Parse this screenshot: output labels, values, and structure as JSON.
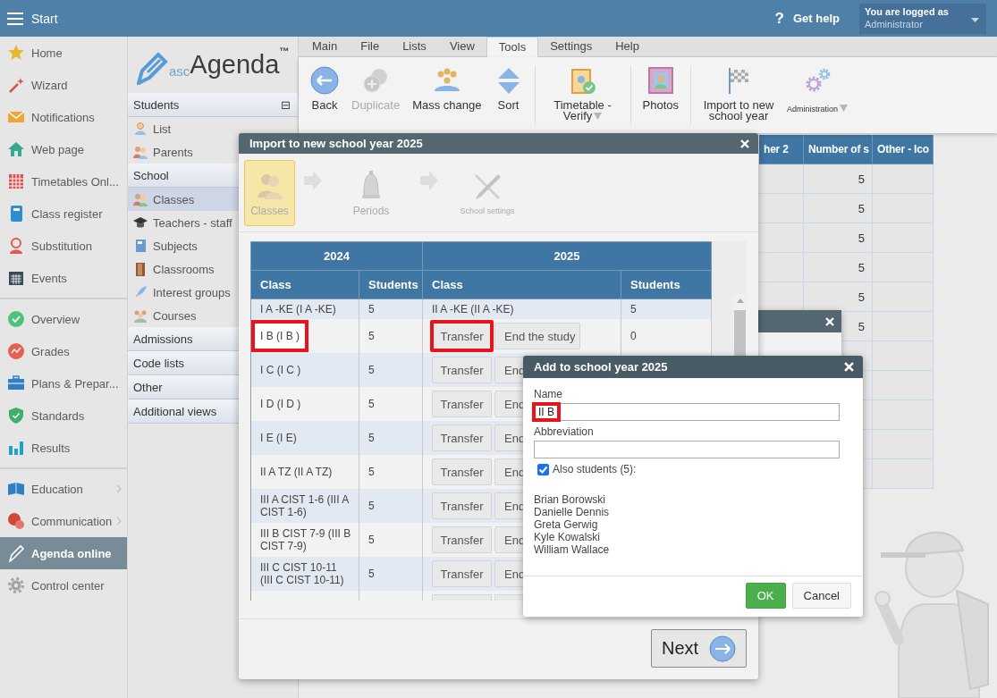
{
  "top_bar": {
    "menu_label": "Start",
    "help_icon": "?",
    "help_label": "Get help",
    "login": {
      "caption": "You are logged as",
      "user": "Administrator"
    }
  },
  "nav": [
    {
      "items": [
        {
          "label": "Home",
          "selected": false,
          "submenu": false
        },
        {
          "label": "Wizard",
          "selected": false,
          "submenu": false
        },
        {
          "label": "Notifications",
          "selected": false,
          "submenu": false
        },
        {
          "label": "Web page",
          "selected": false,
          "submenu": false
        },
        {
          "label": "Timetables Onl...",
          "selected": false,
          "submenu": false
        },
        {
          "label": "Class register",
          "selected": false,
          "submenu": false
        },
        {
          "label": "Substitution",
          "selected": false,
          "submenu": false
        },
        {
          "label": "Events",
          "selected": false,
          "submenu": false
        }
      ]
    },
    {
      "items": [
        {
          "label": "Overview",
          "selected": false,
          "submenu": false
        },
        {
          "label": "Grades",
          "selected": false,
          "submenu": false
        },
        {
          "label": "Plans & Prepar...",
          "selected": false,
          "submenu": false
        },
        {
          "label": "Standards",
          "selected": false,
          "submenu": false
        },
        {
          "label": "Results",
          "selected": false,
          "submenu": false
        }
      ]
    },
    {
      "items": [
        {
          "label": "Education",
          "selected": false,
          "submenu": true
        },
        {
          "label": "Communication",
          "selected": false,
          "submenu": true
        },
        {
          "label": "Agenda online",
          "selected": true,
          "submenu": false
        },
        {
          "label": "Control center",
          "selected": false,
          "submenu": false
        }
      ]
    }
  ],
  "logo": {
    "prefix": "asc",
    "name": "Agenda",
    "mark": "™"
  },
  "side_panel": [
    {
      "title": "Students",
      "toggle": "⊟",
      "items": [
        {
          "label": "List",
          "selected": false
        },
        {
          "label": "Parents",
          "selected": false
        }
      ]
    },
    {
      "title": "School",
      "items": [
        {
          "label": "Classes",
          "selected": true
        },
        {
          "label": "Teachers - staff",
          "selected": false
        },
        {
          "label": "Subjects",
          "selected": false
        },
        {
          "label": "Classrooms",
          "selected": false
        },
        {
          "label": "Interest groups",
          "selected": false
        },
        {
          "label": "Courses",
          "selected": false
        }
      ]
    },
    {
      "title": "Admissions"
    },
    {
      "title": "Code lists"
    },
    {
      "title": "Other"
    },
    {
      "title": "Additional views"
    }
  ],
  "ribbon": {
    "tabs": [
      {
        "label": "Main",
        "selected": false
      },
      {
        "label": "File",
        "selected": false
      },
      {
        "label": "Lists",
        "selected": false
      },
      {
        "label": "View",
        "selected": false
      },
      {
        "label": "Tools",
        "selected": true
      },
      {
        "label": "Settings",
        "selected": false
      },
      {
        "label": "Help",
        "selected": false
      }
    ],
    "groups": [
      [
        {
          "label": "Back",
          "disabled": false,
          "dropdown": false,
          "kind": "large"
        },
        {
          "label": "Duplicate",
          "disabled": true,
          "dropdown": false,
          "kind": "large"
        },
        {
          "label": "Mass change",
          "disabled": false,
          "dropdown": false,
          "kind": "large"
        },
        {
          "label": "Sort",
          "disabled": false,
          "dropdown": false,
          "kind": "large"
        }
      ],
      [
        {
          "label": "Timetable - Verify",
          "disabled": false,
          "dropdown": true,
          "kind": "large"
        }
      ],
      [
        {
          "label": "Photos",
          "disabled": false,
          "dropdown": false,
          "kind": "large"
        }
      ],
      [
        {
          "label": "Import to new school year",
          "disabled": false,
          "dropdown": false,
          "kind": "large"
        },
        {
          "label": "Administration",
          "disabled": false,
          "dropdown": true,
          "kind": "compact"
        }
      ]
    ]
  },
  "grid": {
    "columns": [
      "her 2",
      "Number of s",
      "Other - Ico"
    ],
    "rows": [
      {
        "number": "5"
      },
      {
        "number": "5"
      },
      {
        "number": "5"
      },
      {
        "number": "5"
      },
      {
        "number": "5"
      },
      {
        "number": "5"
      }
    ]
  },
  "import_dialog": {
    "title": "Import to new school year 2025",
    "steps": [
      {
        "label": "Classes",
        "selected": true
      },
      {
        "label": "Periods",
        "selected": false
      },
      {
        "label": "School settings",
        "selected": false
      }
    ],
    "table": {
      "years": [
        "2024",
        "2025"
      ],
      "columns": [
        "Class",
        "Students",
        "Class",
        "Students"
      ],
      "rows": [
        {
          "kind": "mapped",
          "class": "I A -KE (I A -KE)",
          "students": "5",
          "new_class": "II A -KE (II A -KE)",
          "new_students": "5",
          "marked": false
        },
        {
          "kind": "choice",
          "class": "I B (I B )",
          "students": "5",
          "transfer": "Transfer",
          "transfer_marked": true,
          "end": "End the study",
          "new_students": "0",
          "marked": true
        },
        {
          "kind": "choice",
          "class": "I C (I C )",
          "students": "5",
          "transfer": "Transfer",
          "transfer_marked": false,
          "end": "End",
          "marked": false
        },
        {
          "kind": "choice",
          "class": "I D (I D )",
          "students": "5",
          "transfer": "Transfer",
          "transfer_marked": false,
          "end": "End",
          "marked": false
        },
        {
          "kind": "choice",
          "class": "I E (I E)",
          "students": "5",
          "transfer": "Transfer",
          "transfer_marked": false,
          "end": "End",
          "marked": false
        },
        {
          "kind": "choice",
          "class": "II A TZ (II A TZ)",
          "students": "5",
          "transfer": "Transfer",
          "transfer_marked": false,
          "end": "End",
          "marked": false
        },
        {
          "kind": "choice",
          "class": "III A CIST 1-6 (III A CIST 1-6)",
          "students": "5",
          "transfer": "Transfer",
          "transfer_marked": false,
          "end": "End",
          "marked": false
        },
        {
          "kind": "choice",
          "class": "III B CIST 7-9 (III B CIST 7-9)",
          "students": "5",
          "transfer": "Transfer",
          "transfer_marked": false,
          "end": "End",
          "marked": false
        },
        {
          "kind": "choice",
          "class": "III C CIST 10-11 (III C CIST 10-11)",
          "students": "5",
          "transfer": "Transfer",
          "transfer_marked": false,
          "end": "End",
          "marked": false
        },
        {
          "kind": "cut"
        }
      ]
    },
    "next_button": "Next"
  },
  "add_dialog": {
    "title": "Add to school year 2025",
    "fields": [
      {
        "label": "Name",
        "value": "II B",
        "marked": true
      },
      {
        "label": "Abbreviation"
      }
    ],
    "also_students": {
      "label": "Also students (5):",
      "checked": true
    },
    "students": [
      "Brian Borowski",
      "Danielle Dennis",
      "Greta Gerwig",
      "Kyle Kowalski",
      "William Wallace"
    ],
    "buttons": [
      {
        "label": "OK",
        "kind": "primary"
      },
      {
        "label": "Cancel",
        "kind": "secondary"
      }
    ]
  }
}
